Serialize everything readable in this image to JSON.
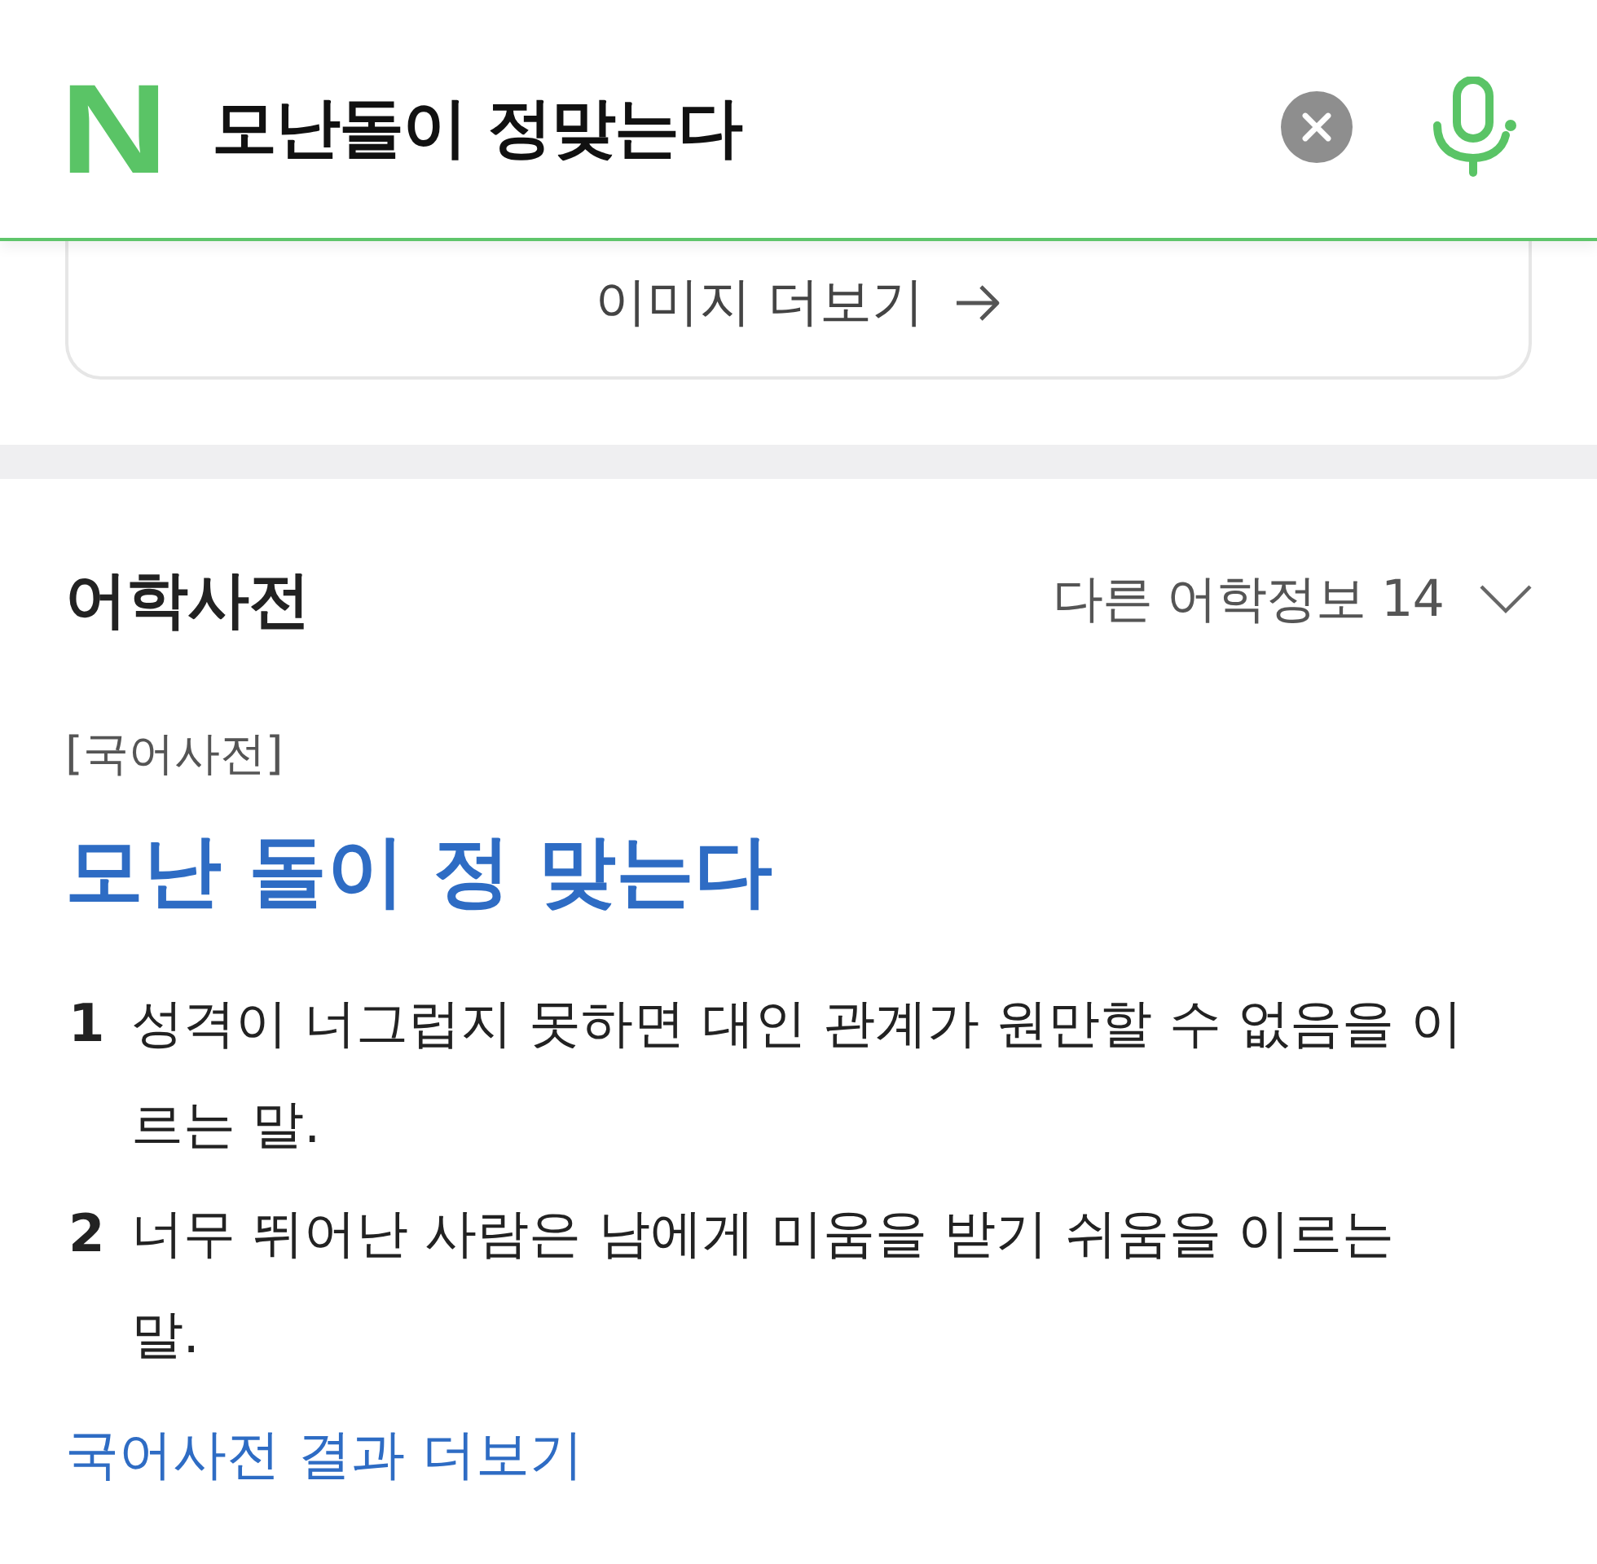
{
  "search_bar": {
    "logo": "N",
    "query": "모난돌이 정맞는다"
  },
  "image_more_button": {
    "label": "이미지 더보기"
  },
  "dictionary": {
    "title": "어학사전",
    "other_info": {
      "label": "다른 어학정보 14",
      "expanded": false
    },
    "source": "[국어사전]",
    "headword": "모난 돌이 정 맞는다",
    "definitions": [
      {
        "number": "1",
        "text": "성격이 너그럽지 못하면 대인 관계가 원만할 수 없음을 이르는 말."
      },
      {
        "number": "2",
        "text": "너무 뛰어난 사람은 남에게 미움을 받기 쉬움을 이르는 말."
      }
    ],
    "more_link": "국어사전 결과 더보기"
  }
}
